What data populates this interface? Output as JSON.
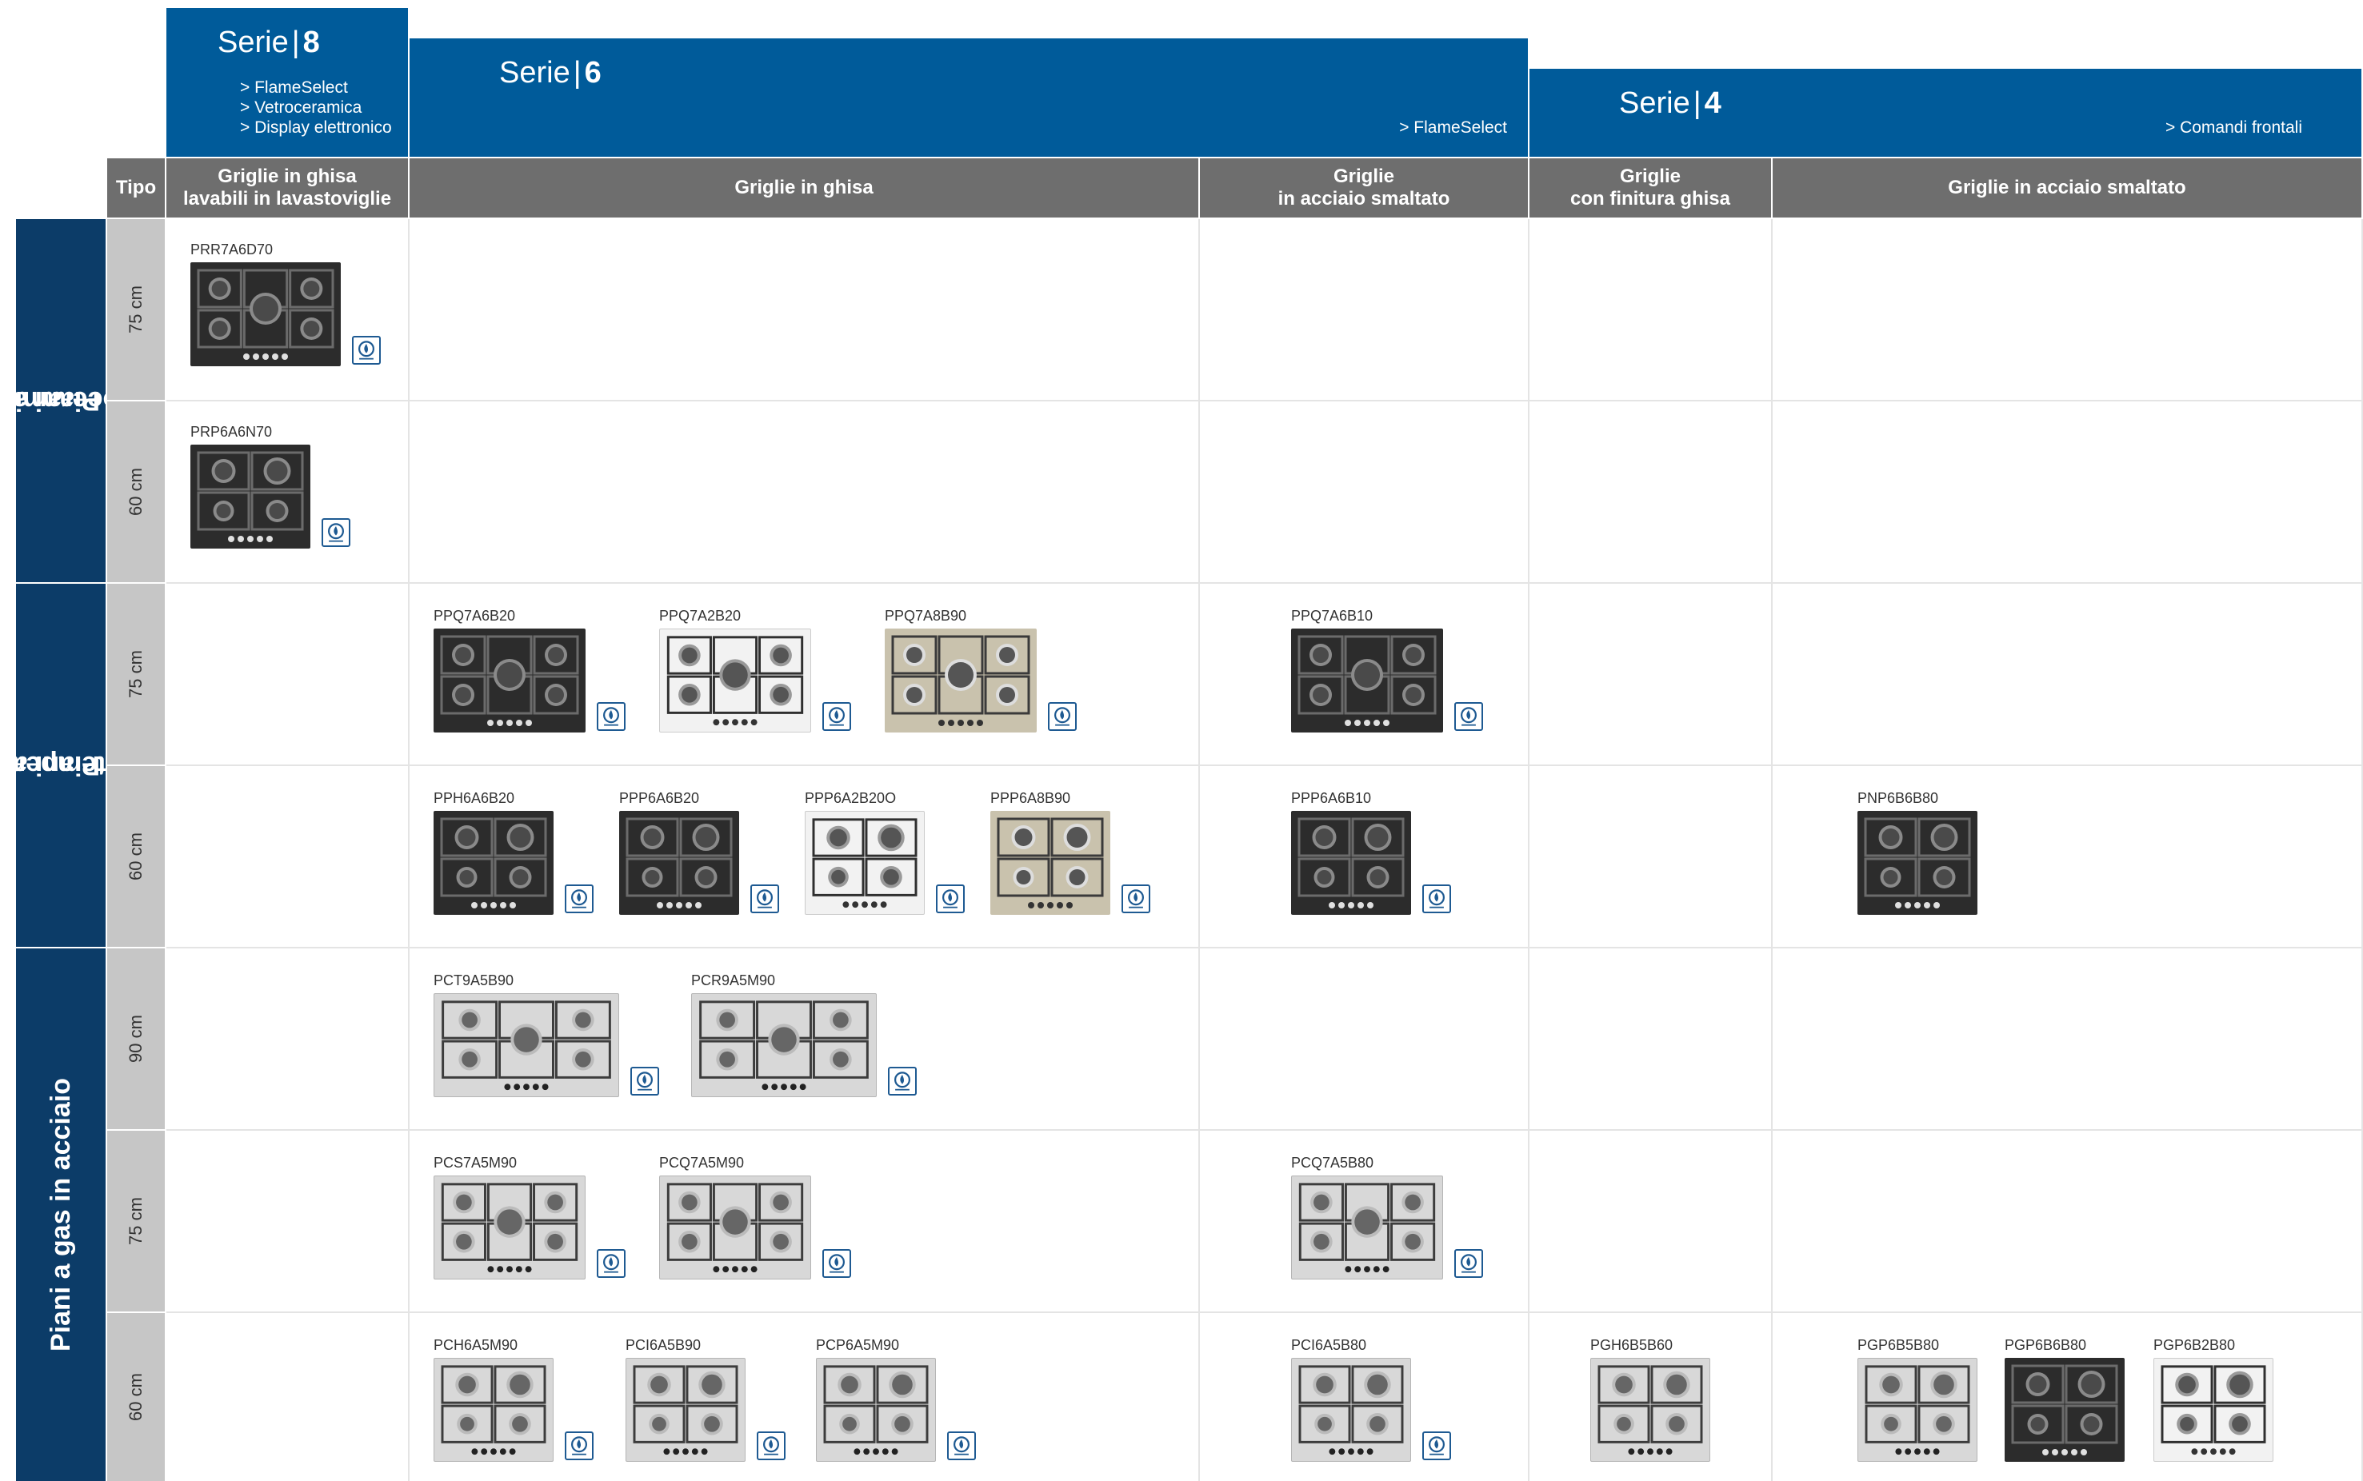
{
  "series": {
    "s8": {
      "label": "Serie",
      "number": "8",
      "features": [
        "> FlameSelect",
        "> Vetroceramica",
        "> Display elettronico"
      ]
    },
    "s6": {
      "label": "Serie",
      "number": "6",
      "features": [
        "> FlameSelect"
      ]
    },
    "s4": {
      "label": "Serie",
      "number": "4",
      "features": [
        "> Comandi frontali"
      ]
    }
  },
  "columns": {
    "tipo": "Tipo",
    "c1": [
      "Griglie in ghisa",
      "lavabili in lavastoviglie"
    ],
    "c2": [
      "Griglie in ghisa"
    ],
    "c3": [
      "Griglie",
      "in acciaio smaltato"
    ],
    "c4": [
      "Griglie",
      "con finitura ghisa"
    ],
    "c5": [
      "Griglie in acciaio smaltato"
    ]
  },
  "categories": {
    "vetroceramica": [
      "Piani a gas",
      "in vetroceramica"
    ],
    "vetro": [
      "Piani a gas",
      "in vetro temperato"
    ],
    "acciaio": [
      "Piani a gas in acciaio"
    ]
  },
  "sizes": {
    "r1": "75 cm",
    "r2": "60 cm",
    "r3": "75 cm",
    "r4": "60 cm",
    "r5": "90 cm",
    "r6": "75 cm",
    "r7": "60 cm"
  },
  "products": {
    "PRR7A6D70": {
      "code": "PRR7A6D70",
      "finish": "dark",
      "flameselect": true
    },
    "PRP6A6N70": {
      "code": "PRP6A6N70",
      "finish": "dark",
      "flameselect": true
    },
    "PPQ7A6B20": {
      "code": "PPQ7A6B20",
      "finish": "dark",
      "flameselect": true
    },
    "PPQ7A2B20": {
      "code": "PPQ7A2B20",
      "finish": "white",
      "flameselect": true
    },
    "PPQ7A8B90": {
      "code": "PPQ7A8B90",
      "finish": "beige",
      "flameselect": true
    },
    "PPQ7A6B10": {
      "code": "PPQ7A6B10",
      "finish": "dark",
      "flameselect": true
    },
    "PPH6A6B20": {
      "code": "PPH6A6B20",
      "finish": "dark",
      "flameselect": true
    },
    "PPP6A6B20": {
      "code": "PPP6A6B20",
      "finish": "dark",
      "flameselect": true
    },
    "PPP6A2B20O": {
      "code": "PPP6A2B20O",
      "finish": "white",
      "flameselect": true
    },
    "PPP6A8B90": {
      "code": "PPP6A8B90",
      "finish": "beige",
      "flameselect": true
    },
    "PPP6A6B10": {
      "code": "PPP6A6B10",
      "finish": "dark",
      "flameselect": true
    },
    "PNP6B6B80": {
      "code": "PNP6B6B80",
      "finish": "dark",
      "flameselect": false
    },
    "PCT9A5B90": {
      "code": "PCT9A5B90",
      "finish": "steel",
      "flameselect": true
    },
    "PCR9A5M90": {
      "code": "PCR9A5M90",
      "finish": "steel",
      "flameselect": true
    },
    "PCS7A5M90": {
      "code": "PCS7A5M90",
      "finish": "steel",
      "flameselect": true
    },
    "PCQ7A5M90": {
      "code": "PCQ7A5M90",
      "finish": "steel",
      "flameselect": true
    },
    "PCQ7A5B80": {
      "code": "PCQ7A5B80",
      "finish": "steel",
      "flameselect": true
    },
    "PCH6A5M90": {
      "code": "PCH6A5M90",
      "finish": "steel",
      "flameselect": true
    },
    "PCI6A5B90": {
      "code": "PCI6A5B90",
      "finish": "steel",
      "flameselect": true
    },
    "PCP6A5M90": {
      "code": "PCP6A5M90",
      "finish": "steel",
      "flameselect": true
    },
    "PCI6A5B80": {
      "code": "PCI6A5B80",
      "finish": "steel",
      "flameselect": true
    },
    "PGH6B5B60": {
      "code": "PGH6B5B60",
      "finish": "steel",
      "flameselect": false
    },
    "PGP6B5B80": {
      "code": "PGP6B5B80",
      "finish": "steel",
      "flameselect": false
    },
    "PGP6B6B80": {
      "code": "PGP6B6B80",
      "finish": "dark",
      "flameselect": false
    },
    "PGP6B2B80": {
      "code": "PGP6B2B80",
      "finish": "white",
      "flameselect": false
    }
  },
  "icons": {
    "hob": "hob-image-icon",
    "flameselect": "flameselect-badge-icon"
  },
  "colors": {
    "serie_blue": "#005b9a",
    "category_navy": "#0c3c68",
    "header_gray": "#6e6e6e",
    "size_gray": "#c6c6c6"
  }
}
